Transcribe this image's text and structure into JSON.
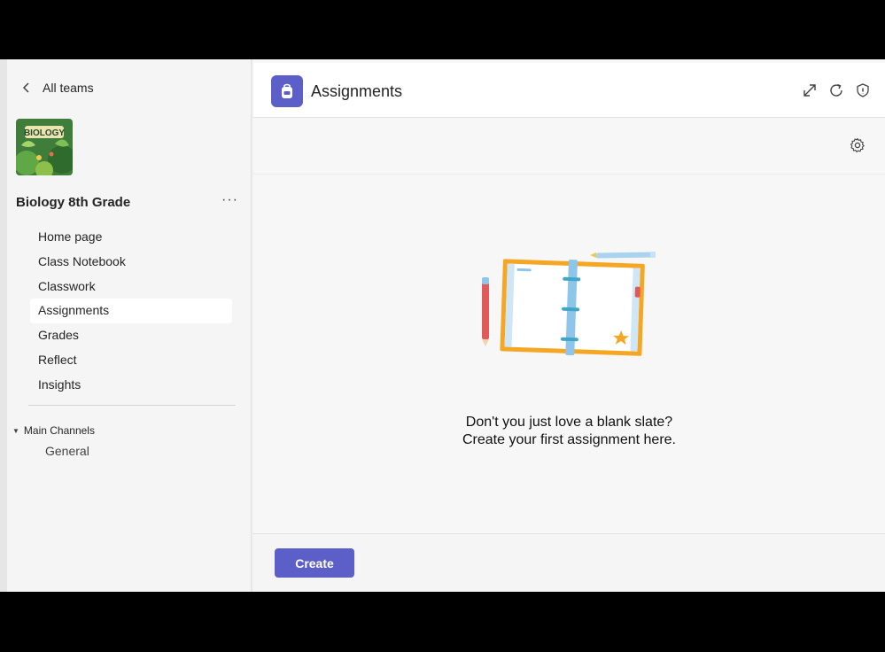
{
  "sidebar": {
    "back_label": "All teams",
    "team_name": "Biology 8th Grade",
    "more_label": "···",
    "nav": [
      "Home page",
      "Class Notebook",
      "Classwork",
      "Assignments",
      "Grades",
      "Reflect",
      "Insights"
    ],
    "active_nav": "Assignments",
    "channels_header": "Main Channels",
    "channels": [
      "General"
    ]
  },
  "header": {
    "title": "Assignments",
    "icons": [
      "expand-icon",
      "refresh-icon",
      "shield-icon"
    ]
  },
  "empty_state": {
    "line1": "Don't you just love a blank slate?",
    "line2": "Create your first assignment here."
  },
  "footer": {
    "create_label": "Create"
  },
  "colors": {
    "accent": "#5b5fc7",
    "notebook_border": "#f5a623",
    "spine": "#8ec5ea",
    "pencil_red": "#e05a5a"
  }
}
